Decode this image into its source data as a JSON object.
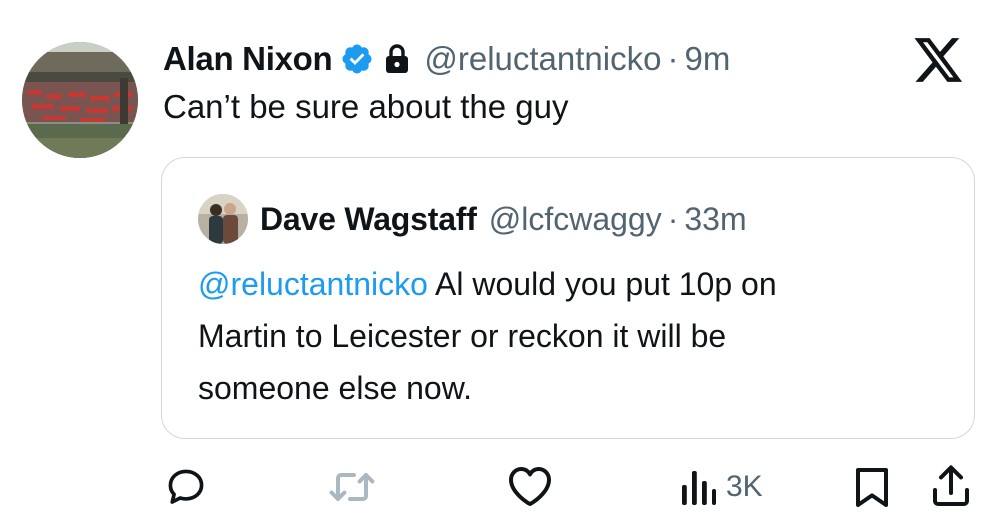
{
  "tweet": {
    "author_name": "Alan Nixon",
    "handle": "@reluctantnicko",
    "separator": "·",
    "time": "9m",
    "text": "Can’t be sure about the guy"
  },
  "quote": {
    "author_name": "Dave Wagstaff",
    "handle": "@lcfcwaggy",
    "separator": "·",
    "time": "33m",
    "mention": "@reluctantnicko",
    "line1_rest": " Al would you put 10p on",
    "line2": "Martin to Leicester or reckon it will be",
    "line3": "someone else now."
  },
  "actions": {
    "views": "3K"
  },
  "icons": {
    "verified": "verified-badge-icon",
    "lock": "lock-icon",
    "brand": "x-logo-icon",
    "reply": "reply-icon",
    "retweet": "retweet-icon",
    "like": "like-icon",
    "views": "views-icon",
    "bookmark": "bookmark-icon",
    "share": "share-icon"
  },
  "colors": {
    "accent": "#1d9bf0",
    "text": "#0f1419",
    "muted": "#536471",
    "border": "#cfd9de"
  }
}
